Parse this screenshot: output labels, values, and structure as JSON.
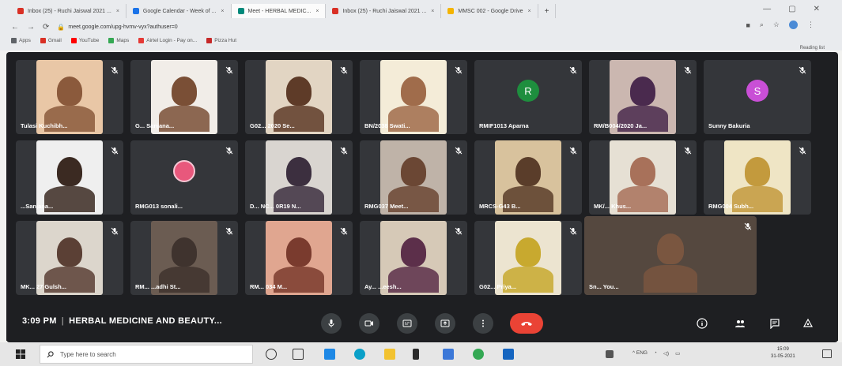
{
  "browser": {
    "tabs": [
      {
        "label": "Inbox (25) - Ruchi Jaiswal 2021 ... ",
        "color": "#d93025",
        "active": false
      },
      {
        "label": "Google Calendar - Week of ...",
        "color": "#1a73e8",
        "active": false
      },
      {
        "label": "Meet - HERBAL MEDIC...",
        "color": "#00897b",
        "active": true
      },
      {
        "label": "Inbox (25) - Ruchi Jaiswal 2021 ...",
        "color": "#d93025",
        "active": false
      },
      {
        "label": "MMSC 002 - Google Drive",
        "color": "#f4b400",
        "active": false
      }
    ],
    "url": "meet.google.com/upg-hvmv-vyx?authuser=0",
    "bookmarks": [
      {
        "label": "Apps",
        "color": "#5f6368"
      },
      {
        "label": "Gmail",
        "color": "#d93025"
      },
      {
        "label": "YouTube",
        "color": "#ff0000"
      },
      {
        "label": "Maps",
        "color": "#34a853"
      },
      {
        "label": "Airtel Login - Pay on...",
        "color": "#e53935"
      },
      {
        "label": "Pizza Hut",
        "color": "#c62828"
      }
    ],
    "reading_list": "Reading list"
  },
  "meeting": {
    "time": "3:09 PM",
    "title": "HERBAL MEDICINE AND BEAUTY...",
    "participants": [
      {
        "name": "Tulasi Kuchibh...",
        "kind": "video",
        "bg": "#e9c7a6",
        "skin": "#8b5a3c"
      },
      {
        "name": "G... Sanjana...",
        "kind": "video",
        "bg": "#f1ede8",
        "skin": "#7a4f36"
      },
      {
        "name": "G02... 2020 Se...",
        "kind": "video",
        "bg": "#e2d5c3",
        "skin": "#5e3b28"
      },
      {
        "name": "BN/2038 Swati...",
        "kind": "video",
        "bg": "#f4ecd8",
        "skin": "#a06c4b"
      },
      {
        "name": "RMIF1013 Aparna",
        "kind": "avatar",
        "letter": "R",
        "avatar_color": "#1e8e3e"
      },
      {
        "name": "RM/B004/2020 Ja...",
        "kind": "video",
        "bg": "#cbb7b0",
        "skin": "#4a2a4e"
      },
      {
        "name": "Sunny Bakuria",
        "kind": "avatar",
        "letter": "S",
        "avatar_color": "#c94fd6"
      },
      {
        "name": "...Sanjana...",
        "kind": "video",
        "bg": "#efefef",
        "skin": "#3b2a22"
      },
      {
        "name": "RMG013 sonali...",
        "kind": "photo",
        "avatar_color": "#e8587c"
      },
      {
        "name": "D... NC... 0R19 N...",
        "kind": "video",
        "bg": "#d9d5d0",
        "skin": "#3c2f3f"
      },
      {
        "name": "RMG037 Meet...",
        "kind": "video",
        "bg": "#bfb3a8",
        "skin": "#6b4734"
      },
      {
        "name": "MRCS-G43 B...",
        "kind": "video",
        "bg": "#d8c29d",
        "skin": "#5a3d2a"
      },
      {
        "name": "MK/... Khus...",
        "kind": "video",
        "bg": "#e6e0d4",
        "skin": "#a8715a"
      },
      {
        "name": "RMG004 Subh...",
        "kind": "video",
        "bg": "#efe5c5",
        "skin": "#c39a3d"
      },
      {
        "name": "MK... 27 Gulsh...",
        "kind": "video",
        "bg": "#dcd6cc",
        "skin": "#5b4035"
      },
      {
        "name": "RM... ...adhi St...",
        "kind": "video",
        "bg": "#6b5c52",
        "skin": "#3f332e"
      },
      {
        "name": "RM... 034 M...",
        "kind": "video",
        "bg": "#e0a690",
        "skin": "#7a3b2e"
      },
      {
        "name": "Ay... ...eesh...",
        "kind": "video",
        "bg": "#d6c9b7",
        "skin": "#5c2f4a"
      },
      {
        "name": "G02... Priya...",
        "kind": "video",
        "bg": "#ece4d0",
        "skin": "#c8a92f"
      },
      {
        "name": "Sn... You...",
        "kind": "video",
        "bg": "#55483f",
        "skin": "#7a5640"
      }
    ]
  },
  "controls": {
    "mic": "mic-icon",
    "camera": "camera-icon",
    "captions": "captions-icon",
    "present": "present-icon",
    "more": "more-options-icon",
    "end": "end-call-icon",
    "info": "info-icon",
    "people": "people-icon",
    "chat": "chat-icon",
    "activities": "activities-icon"
  },
  "taskbar": {
    "search_placeholder": "Type here to search",
    "tray_text": "^ ENG",
    "clock_time": "15:09",
    "clock_date": "31-05-2021"
  }
}
